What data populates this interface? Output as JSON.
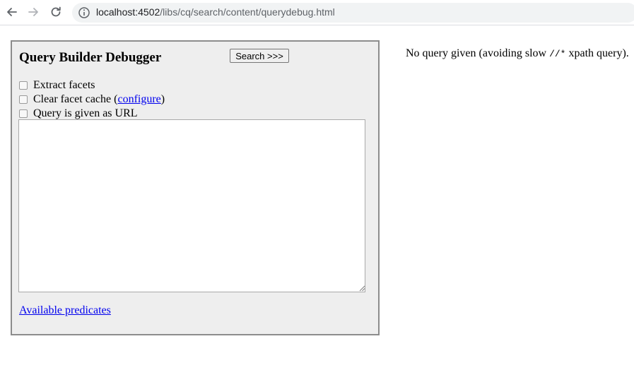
{
  "browser": {
    "url_host": "localhost:4502",
    "url_path": "/libs/cq/search/content/querydebug.html"
  },
  "panel": {
    "title": "Query Builder Debugger",
    "search_label": "Search >>>",
    "options": {
      "extract_facets": "Extract facets",
      "clear_cache_prefix": "Clear facet cache (",
      "configure_link": "configure",
      "clear_cache_suffix": ")",
      "query_as_url": "Query is given as URL"
    },
    "query_value": "",
    "predicates_link": "Available predicates"
  },
  "result": {
    "before": "No query given (avoiding slow ",
    "code": "//*",
    "after": " xpath query)."
  },
  "colors": {
    "panel_bg": "#eeeeee",
    "link": "#0000ee",
    "omnibox": "#f1f3f4"
  }
}
